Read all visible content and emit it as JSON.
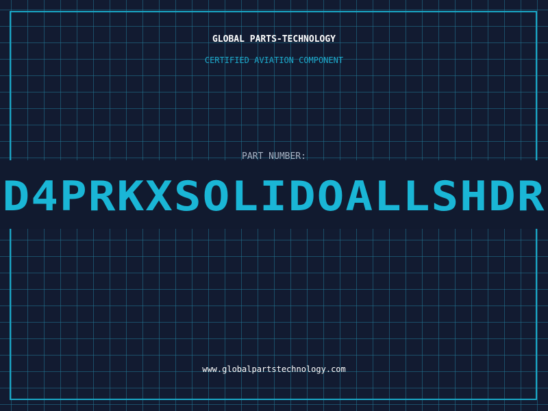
{
  "header": {
    "brand": "GLOBAL PARTS-TECHNOLOGY",
    "tagline": "CERTIFIED AVIATION COMPONENT"
  },
  "part": {
    "label": "PART NUMBER:",
    "value": "D4PRKXSOLIDOALLSHDR"
  },
  "footer": {
    "url": "www.globalpartstechnology.com"
  },
  "colors": {
    "background": "#121b31",
    "grid": "#23788f",
    "accent": "#1aa7c6",
    "part_number": "#1ab6d6",
    "label": "#a8b4c4",
    "text": "#ffffff"
  }
}
